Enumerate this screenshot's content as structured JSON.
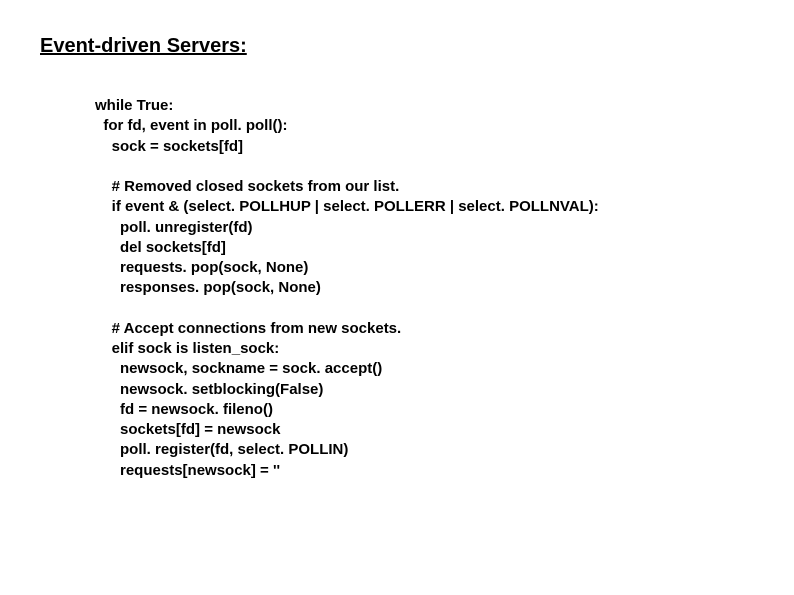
{
  "title": "Event-driven Servers:",
  "code": {
    "line1": "while True:",
    "line2": "  for fd, event in poll. poll():",
    "line3": "    sock = sockets[fd]",
    "line4": "",
    "line5": "    # Removed closed sockets from our list.",
    "line6": "    if event & (select. POLLHUP | select. POLLERR | select. POLLNVAL):",
    "line7": "      poll. unregister(fd)",
    "line8": "      del sockets[fd]",
    "line9": "      requests. pop(sock, None)",
    "line10": "      responses. pop(sock, None)",
    "line11": "",
    "line12": "    # Accept connections from new sockets.",
    "line13": "    elif sock is listen_sock:",
    "line14": "      newsock, sockname = sock. accept()",
    "line15": "      newsock. setblocking(False)",
    "line16": "      fd = newsock. fileno()",
    "line17": "      sockets[fd] = newsock",
    "line18": "      poll. register(fd, select. POLLIN)",
    "line19": "      requests[newsock] = ''"
  }
}
